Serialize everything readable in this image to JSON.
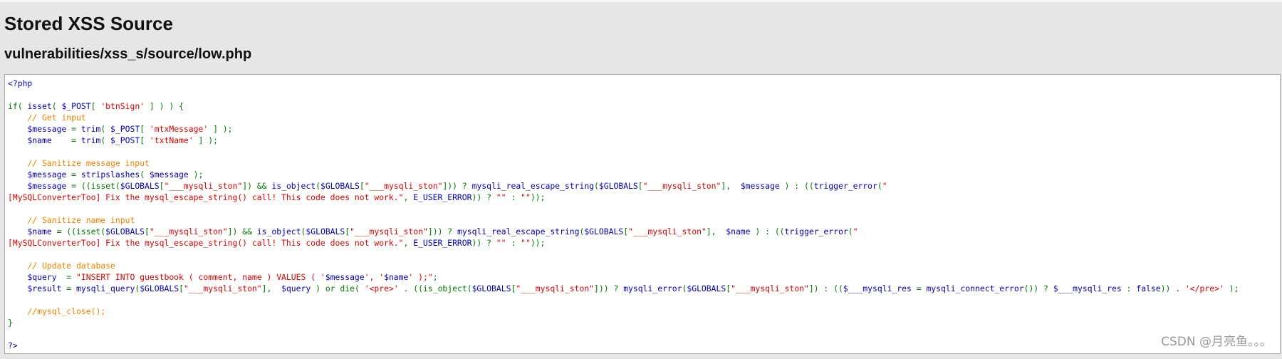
{
  "page": {
    "title": "Stored XSS Source",
    "path": "vulnerabilities/xss_s/source/low.php"
  },
  "theme": {
    "background": "#e6e6e6",
    "code_background": "#ffffff",
    "default_color": "#0000bb",
    "keyword_color": "#007700",
    "string_color": "#dd0000",
    "comment_color": "#ff8000"
  },
  "code_lines": [
    [
      {
        "t": "default",
        "s": "<?php"
      }
    ],
    [],
    [
      {
        "t": "keyword",
        "s": "if( "
      },
      {
        "t": "default",
        "s": "isset"
      },
      {
        "t": "keyword",
        "s": "( "
      },
      {
        "t": "default",
        "s": "$_POST"
      },
      {
        "t": "keyword",
        "s": "[ "
      },
      {
        "t": "string",
        "s": "'btnSign'"
      },
      {
        "t": "keyword",
        "s": " ] ) ) {"
      }
    ],
    [
      {
        "t": "keyword",
        "s": "    "
      },
      {
        "t": "comment",
        "s": "// Get input"
      }
    ],
    [
      {
        "t": "keyword",
        "s": "    "
      },
      {
        "t": "default",
        "s": "$message"
      },
      {
        "t": "keyword",
        "s": " = "
      },
      {
        "t": "default",
        "s": "trim"
      },
      {
        "t": "keyword",
        "s": "( "
      },
      {
        "t": "default",
        "s": "$_POST"
      },
      {
        "t": "keyword",
        "s": "[ "
      },
      {
        "t": "string",
        "s": "'mtxMessage'"
      },
      {
        "t": "keyword",
        "s": " ] );"
      }
    ],
    [
      {
        "t": "keyword",
        "s": "    "
      },
      {
        "t": "default",
        "s": "$name"
      },
      {
        "t": "keyword",
        "s": "    = "
      },
      {
        "t": "default",
        "s": "trim"
      },
      {
        "t": "keyword",
        "s": "( "
      },
      {
        "t": "default",
        "s": "$_POST"
      },
      {
        "t": "keyword",
        "s": "[ "
      },
      {
        "t": "string",
        "s": "'txtName'"
      },
      {
        "t": "keyword",
        "s": " ] );"
      }
    ],
    [],
    [
      {
        "t": "keyword",
        "s": "    "
      },
      {
        "t": "comment",
        "s": "// Sanitize message input"
      }
    ],
    [
      {
        "t": "keyword",
        "s": "    "
      },
      {
        "t": "default",
        "s": "$message"
      },
      {
        "t": "keyword",
        "s": " = "
      },
      {
        "t": "default",
        "s": "stripslashes"
      },
      {
        "t": "keyword",
        "s": "( "
      },
      {
        "t": "default",
        "s": "$message"
      },
      {
        "t": "keyword",
        "s": " );"
      }
    ],
    [
      {
        "t": "keyword",
        "s": "    "
      },
      {
        "t": "default",
        "s": "$message"
      },
      {
        "t": "keyword",
        "s": " = ((isset("
      },
      {
        "t": "default",
        "s": "$GLOBALS"
      },
      {
        "t": "keyword",
        "s": "["
      },
      {
        "t": "string",
        "s": "\"___mysqli_ston\""
      },
      {
        "t": "keyword",
        "s": "]) && "
      },
      {
        "t": "default",
        "s": "is_object"
      },
      {
        "t": "keyword",
        "s": "("
      },
      {
        "t": "default",
        "s": "$GLOBALS"
      },
      {
        "t": "keyword",
        "s": "["
      },
      {
        "t": "string",
        "s": "\"___mysqli_ston\""
      },
      {
        "t": "keyword",
        "s": "])) ? "
      },
      {
        "t": "default",
        "s": "mysqli_real_escape_string"
      },
      {
        "t": "keyword",
        "s": "("
      },
      {
        "t": "default",
        "s": "$GLOBALS"
      },
      {
        "t": "keyword",
        "s": "["
      },
      {
        "t": "string",
        "s": "\"___mysqli_ston\""
      },
      {
        "t": "keyword",
        "s": "],  "
      },
      {
        "t": "default",
        "s": "$message"
      },
      {
        "t": "keyword",
        "s": " ) : (("
      },
      {
        "t": "default",
        "s": "trigger_error"
      },
      {
        "t": "keyword",
        "s": "("
      },
      {
        "t": "string",
        "s": "\""
      }
    ],
    [
      {
        "t": "string",
        "s": "[MySQLConverterToo] Fix the mysql_escape_string() call! This code does not work.\""
      },
      {
        "t": "keyword",
        "s": ", "
      },
      {
        "t": "default",
        "s": "E_USER_ERROR"
      },
      {
        "t": "keyword",
        "s": ")) ? "
      },
      {
        "t": "string",
        "s": "\"\""
      },
      {
        "t": "keyword",
        "s": " : "
      },
      {
        "t": "string",
        "s": "\"\""
      },
      {
        "t": "keyword",
        "s": "));"
      }
    ],
    [],
    [
      {
        "t": "keyword",
        "s": "    "
      },
      {
        "t": "comment",
        "s": "// Sanitize name input"
      }
    ],
    [
      {
        "t": "keyword",
        "s": "    "
      },
      {
        "t": "default",
        "s": "$name"
      },
      {
        "t": "keyword",
        "s": " = ((isset("
      },
      {
        "t": "default",
        "s": "$GLOBALS"
      },
      {
        "t": "keyword",
        "s": "["
      },
      {
        "t": "string",
        "s": "\"___mysqli_ston\""
      },
      {
        "t": "keyword",
        "s": "]) && "
      },
      {
        "t": "default",
        "s": "is_object"
      },
      {
        "t": "keyword",
        "s": "("
      },
      {
        "t": "default",
        "s": "$GLOBALS"
      },
      {
        "t": "keyword",
        "s": "["
      },
      {
        "t": "string",
        "s": "\"___mysqli_ston\""
      },
      {
        "t": "keyword",
        "s": "])) ? "
      },
      {
        "t": "default",
        "s": "mysqli_real_escape_string"
      },
      {
        "t": "keyword",
        "s": "("
      },
      {
        "t": "default",
        "s": "$GLOBALS"
      },
      {
        "t": "keyword",
        "s": "["
      },
      {
        "t": "string",
        "s": "\"___mysqli_ston\""
      },
      {
        "t": "keyword",
        "s": "],  "
      },
      {
        "t": "default",
        "s": "$name"
      },
      {
        "t": "keyword",
        "s": " ) : (("
      },
      {
        "t": "default",
        "s": "trigger_error"
      },
      {
        "t": "keyword",
        "s": "("
      },
      {
        "t": "string",
        "s": "\""
      }
    ],
    [
      {
        "t": "string",
        "s": "[MySQLConverterToo] Fix the mysql_escape_string() call! This code does not work.\""
      },
      {
        "t": "keyword",
        "s": ", "
      },
      {
        "t": "default",
        "s": "E_USER_ERROR"
      },
      {
        "t": "keyword",
        "s": ")) ? "
      },
      {
        "t": "string",
        "s": "\"\""
      },
      {
        "t": "keyword",
        "s": " : "
      },
      {
        "t": "string",
        "s": "\"\""
      },
      {
        "t": "keyword",
        "s": "));"
      }
    ],
    [],
    [
      {
        "t": "keyword",
        "s": "    "
      },
      {
        "t": "comment",
        "s": "// Update database"
      }
    ],
    [
      {
        "t": "keyword",
        "s": "    "
      },
      {
        "t": "default",
        "s": "$query"
      },
      {
        "t": "keyword",
        "s": "  = "
      },
      {
        "t": "string",
        "s": "\"INSERT INTO guestbook ( comment, name ) VALUES ( '"
      },
      {
        "t": "default",
        "s": "$message"
      },
      {
        "t": "string",
        "s": "', '"
      },
      {
        "t": "default",
        "s": "$name"
      },
      {
        "t": "string",
        "s": "' );\""
      },
      {
        "t": "keyword",
        "s": ";"
      }
    ],
    [
      {
        "t": "keyword",
        "s": "    "
      },
      {
        "t": "default",
        "s": "$result"
      },
      {
        "t": "keyword",
        "s": " = "
      },
      {
        "t": "default",
        "s": "mysqli_query"
      },
      {
        "t": "keyword",
        "s": "("
      },
      {
        "t": "default",
        "s": "$GLOBALS"
      },
      {
        "t": "keyword",
        "s": "["
      },
      {
        "t": "string",
        "s": "\"___mysqli_ston\""
      },
      {
        "t": "keyword",
        "s": "],  "
      },
      {
        "t": "default",
        "s": "$query"
      },
      {
        "t": "keyword",
        "s": " ) or die( "
      },
      {
        "t": "string",
        "s": "'<pre>'"
      },
      {
        "t": "keyword",
        "s": " . ((is_object("
      },
      {
        "t": "default",
        "s": "$GLOBALS"
      },
      {
        "t": "keyword",
        "s": "["
      },
      {
        "t": "string",
        "s": "\"___mysqli_ston\""
      },
      {
        "t": "keyword",
        "s": "])) ? "
      },
      {
        "t": "default",
        "s": "mysqli_error"
      },
      {
        "t": "keyword",
        "s": "("
      },
      {
        "t": "default",
        "s": "$GLOBALS"
      },
      {
        "t": "keyword",
        "s": "["
      },
      {
        "t": "string",
        "s": "\"___mysqli_ston\""
      },
      {
        "t": "keyword",
        "s": "]) : (("
      },
      {
        "t": "default",
        "s": "$___mysqli_res"
      },
      {
        "t": "keyword",
        "s": " = "
      },
      {
        "t": "default",
        "s": "mysqli_connect_error"
      },
      {
        "t": "keyword",
        "s": "()) ? "
      },
      {
        "t": "default",
        "s": "$___mysqli_res"
      },
      {
        "t": "keyword",
        "s": " : "
      },
      {
        "t": "default",
        "s": "false"
      },
      {
        "t": "keyword",
        "s": ")) . "
      },
      {
        "t": "string",
        "s": "'</pre>'"
      },
      {
        "t": "keyword",
        "s": " );"
      }
    ],
    [],
    [
      {
        "t": "keyword",
        "s": "    "
      },
      {
        "t": "comment",
        "s": "//mysql_close();"
      }
    ],
    [
      {
        "t": "keyword",
        "s": "}"
      }
    ],
    [],
    [
      {
        "t": "default",
        "s": "?>"
      }
    ]
  ],
  "watermark": "CSDN @月亮鱼。。。"
}
